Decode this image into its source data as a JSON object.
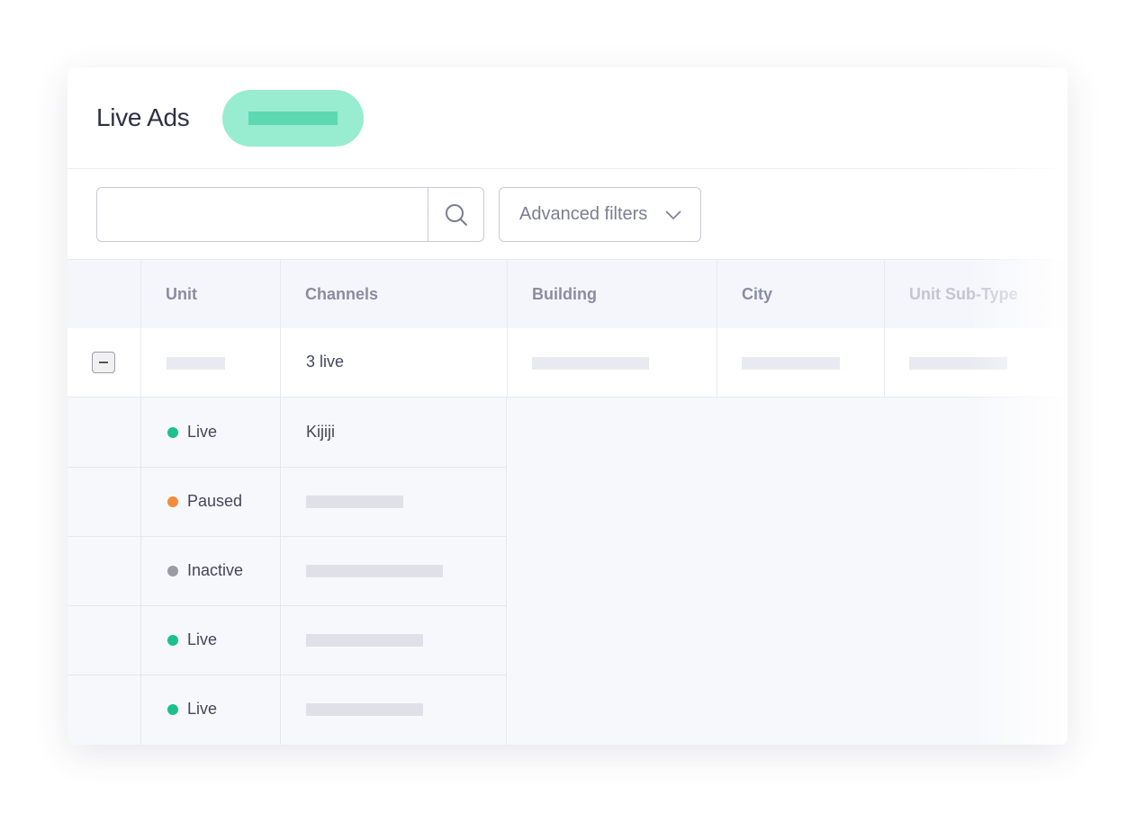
{
  "header": {
    "title": "Live Ads"
  },
  "toolbar": {
    "search_placeholder": "",
    "advanced_filters_label": "Advanced filters"
  },
  "table": {
    "columns": [
      "Unit",
      "Channels",
      "Building",
      "City",
      "Unit Sub-Type"
    ],
    "parent_row": {
      "channels": "3 live"
    },
    "sub_rows": [
      {
        "status": "Live",
        "channel": "Kijiji"
      },
      {
        "status": "Paused",
        "channel": ""
      },
      {
        "status": "Inactive",
        "channel": ""
      },
      {
        "status": "Live",
        "channel": ""
      },
      {
        "status": "Live",
        "channel": ""
      }
    ]
  },
  "colors": {
    "live": "#1dbf8a",
    "paused": "#f28c3b",
    "inactive": "#9a9ba3",
    "accent_pill": "#98ecd0"
  },
  "icons": [
    "search-icon",
    "chevron-down-icon",
    "collapse-icon"
  ]
}
